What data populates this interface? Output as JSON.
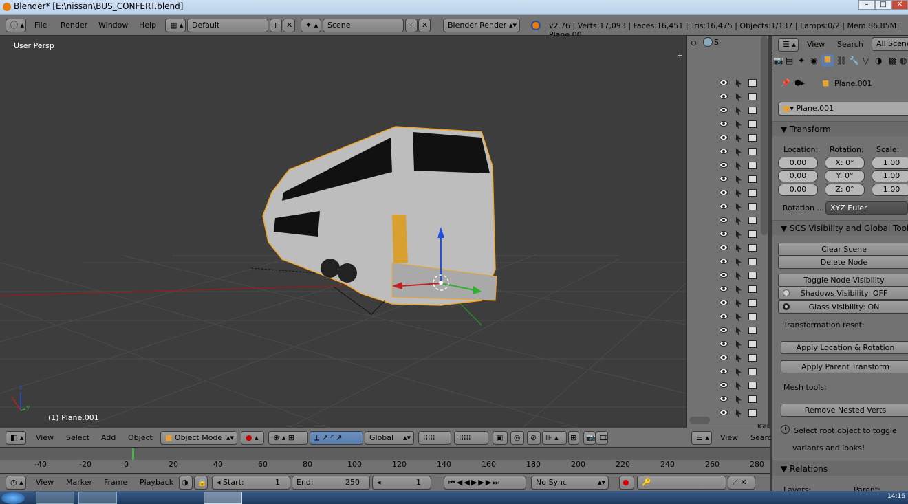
{
  "window": {
    "title": "Blender* [E:\\nissan\\BUS_CONFERT.blend]"
  },
  "menubar": {
    "items": [
      "File",
      "Render",
      "Window",
      "Help"
    ],
    "layout": "Default",
    "scene": "Scene",
    "engine": "Blender Render",
    "stats": "v2.76 | Verts:17,093 | Faces:16,451 | Tris:16,475 | Objects:1/137 | Lamps:0/2 | Mem:86.85M | Plane.00"
  },
  "viewport": {
    "label": "User Persp",
    "object_label": "(1) Plane.001",
    "axis_x": "x",
    "axis_y": "y",
    "axis_z": "z"
  },
  "viewport_header": {
    "menus": [
      "View",
      "Select",
      "Add",
      "Object"
    ],
    "mode": "Object Mode",
    "orientation": "Global"
  },
  "outliner": {
    "root": "S",
    "header_menus": [
      "View",
      "Searc"
    ],
    "footer_text": "IGH"
  },
  "properties": {
    "header": {
      "view": "View",
      "search": "Search",
      "scope": "All Scenes"
    },
    "breadcrumb": "Plane.001",
    "object_name": "Plane.001",
    "transform": {
      "title": "Transform",
      "location_label": "Location:",
      "rotation_label": "Rotation:",
      "scale_label": "Scale:",
      "location": [
        "0.00",
        "0.00",
        "0.00"
      ],
      "rotation": [
        "X:  0°",
        "Y:  0°",
        "Z:  0°"
      ],
      "scale": [
        "1.00",
        "1.00",
        "1.00"
      ],
      "rotation_mode_label": "Rotation ...",
      "rotation_mode": "XYZ Euler"
    },
    "scs": {
      "title": "SCS Visibility and Global Tools",
      "clear_scene": "Clear Scene",
      "delete_node": "Delete Node",
      "toggle_node": "Toggle Node Visibility",
      "shadows": "Shadows Visibility: OFF",
      "glass": "Glass Visibility: ON",
      "reset_label": "Transformation reset:",
      "apply_loc_rot": "Apply Location & Rotation",
      "apply_parent": "Apply Parent Transform",
      "mesh_label": "Mesh tools:",
      "remove_nested": "Remove Nested Verts",
      "hint_line1": "Select root object to toggle",
      "hint_line2": "variants and looks!"
    },
    "relations": {
      "title": "Relations",
      "layers": "Layers:",
      "parent": "Parent:"
    }
  },
  "timeline": {
    "ticks": [
      "-40",
      "-20",
      "0",
      "20",
      "40",
      "60",
      "80",
      "100",
      "120",
      "140",
      "160",
      "180",
      "200",
      "220",
      "240",
      "260",
      "280"
    ]
  },
  "timeline_header": {
    "menus": [
      "View",
      "Marker",
      "Frame",
      "Playback"
    ],
    "start_label": "Start:",
    "start": "1",
    "end_label": "End:",
    "end": "250",
    "current": "1",
    "sync": "No Sync"
  },
  "taskbar": {
    "clock": "14:16"
  },
  "colors": {
    "header": "#727272",
    "viewport": "#3d3d3d",
    "selection": "#f5a623",
    "x_axis": "#c02020",
    "y_axis": "#2fb02f",
    "z_axis": "#2050e0"
  }
}
